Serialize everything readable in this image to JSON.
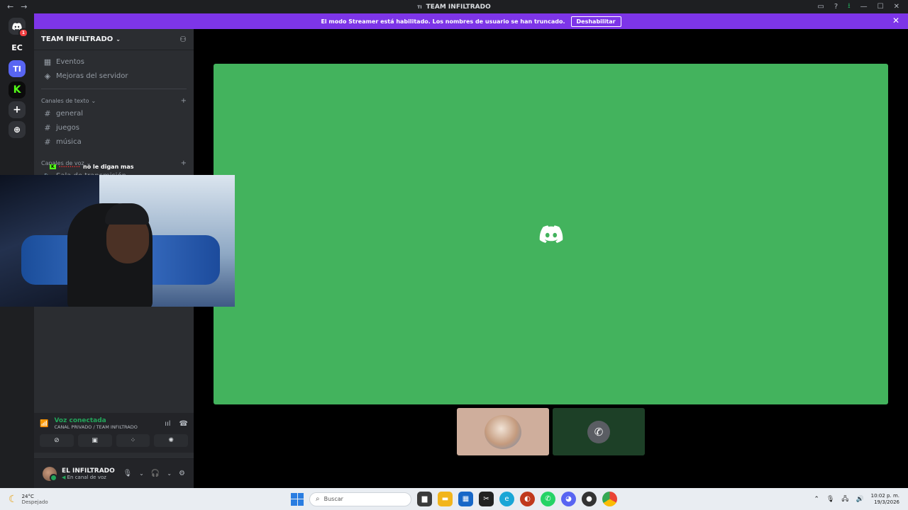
{
  "titlebar": {
    "back": "←",
    "forward": "→",
    "server_badge": "TI",
    "title": "TEAM INFILTRADO",
    "icons": [
      "inbox-icon",
      "help-icon",
      "download-icon",
      "minimize-icon",
      "maximize-icon",
      "close-icon"
    ],
    "download_color": "#23a55a"
  },
  "banner": {
    "message": "El modo Streamer está habilitado. Los nombres de usuario se han truncado.",
    "button": "Deshabilitar",
    "close": "✕",
    "color": "#7d35e8"
  },
  "guilds": [
    {
      "label": "",
      "icon": "discord-home-icon",
      "badge": "1"
    },
    {
      "label": "EC",
      "icon": "",
      "badge": ""
    },
    {
      "label": "TI",
      "icon": "",
      "badge": ""
    },
    {
      "label": "K",
      "icon": "kick-icon",
      "badge": ""
    },
    {
      "label": "+",
      "icon": "add-server-icon",
      "badge": ""
    },
    {
      "label": "⊕",
      "icon": "explore-icon",
      "badge": ""
    }
  ],
  "server": {
    "name": "TEAM INFILTRADO",
    "events": "Eventos",
    "boosts": "Mejoras del servidor",
    "text_category": "Canales de texto",
    "text_channels": [
      "general",
      "juegos",
      "música"
    ],
    "voice_category": "Canales de voz",
    "voice_channels": [
      "Sala de transmisión"
    ]
  },
  "overlay_chat": {
    "badge": "K",
    "user": "··········",
    "message": "no le digan mas"
  },
  "voice": {
    "status": "Voz conectada",
    "channel": "CANAL PRIVADO / TEAM INFILTRADO",
    "status_color": "#23a55a"
  },
  "user": {
    "name": "EL INFILTRADO",
    "status": "En canal de voz"
  },
  "taskbar": {
    "temp": "24°C",
    "condition": "Despejado",
    "search_placeholder": "Buscar",
    "time": "10:02 p. m.",
    "date": "19/3/2026"
  }
}
